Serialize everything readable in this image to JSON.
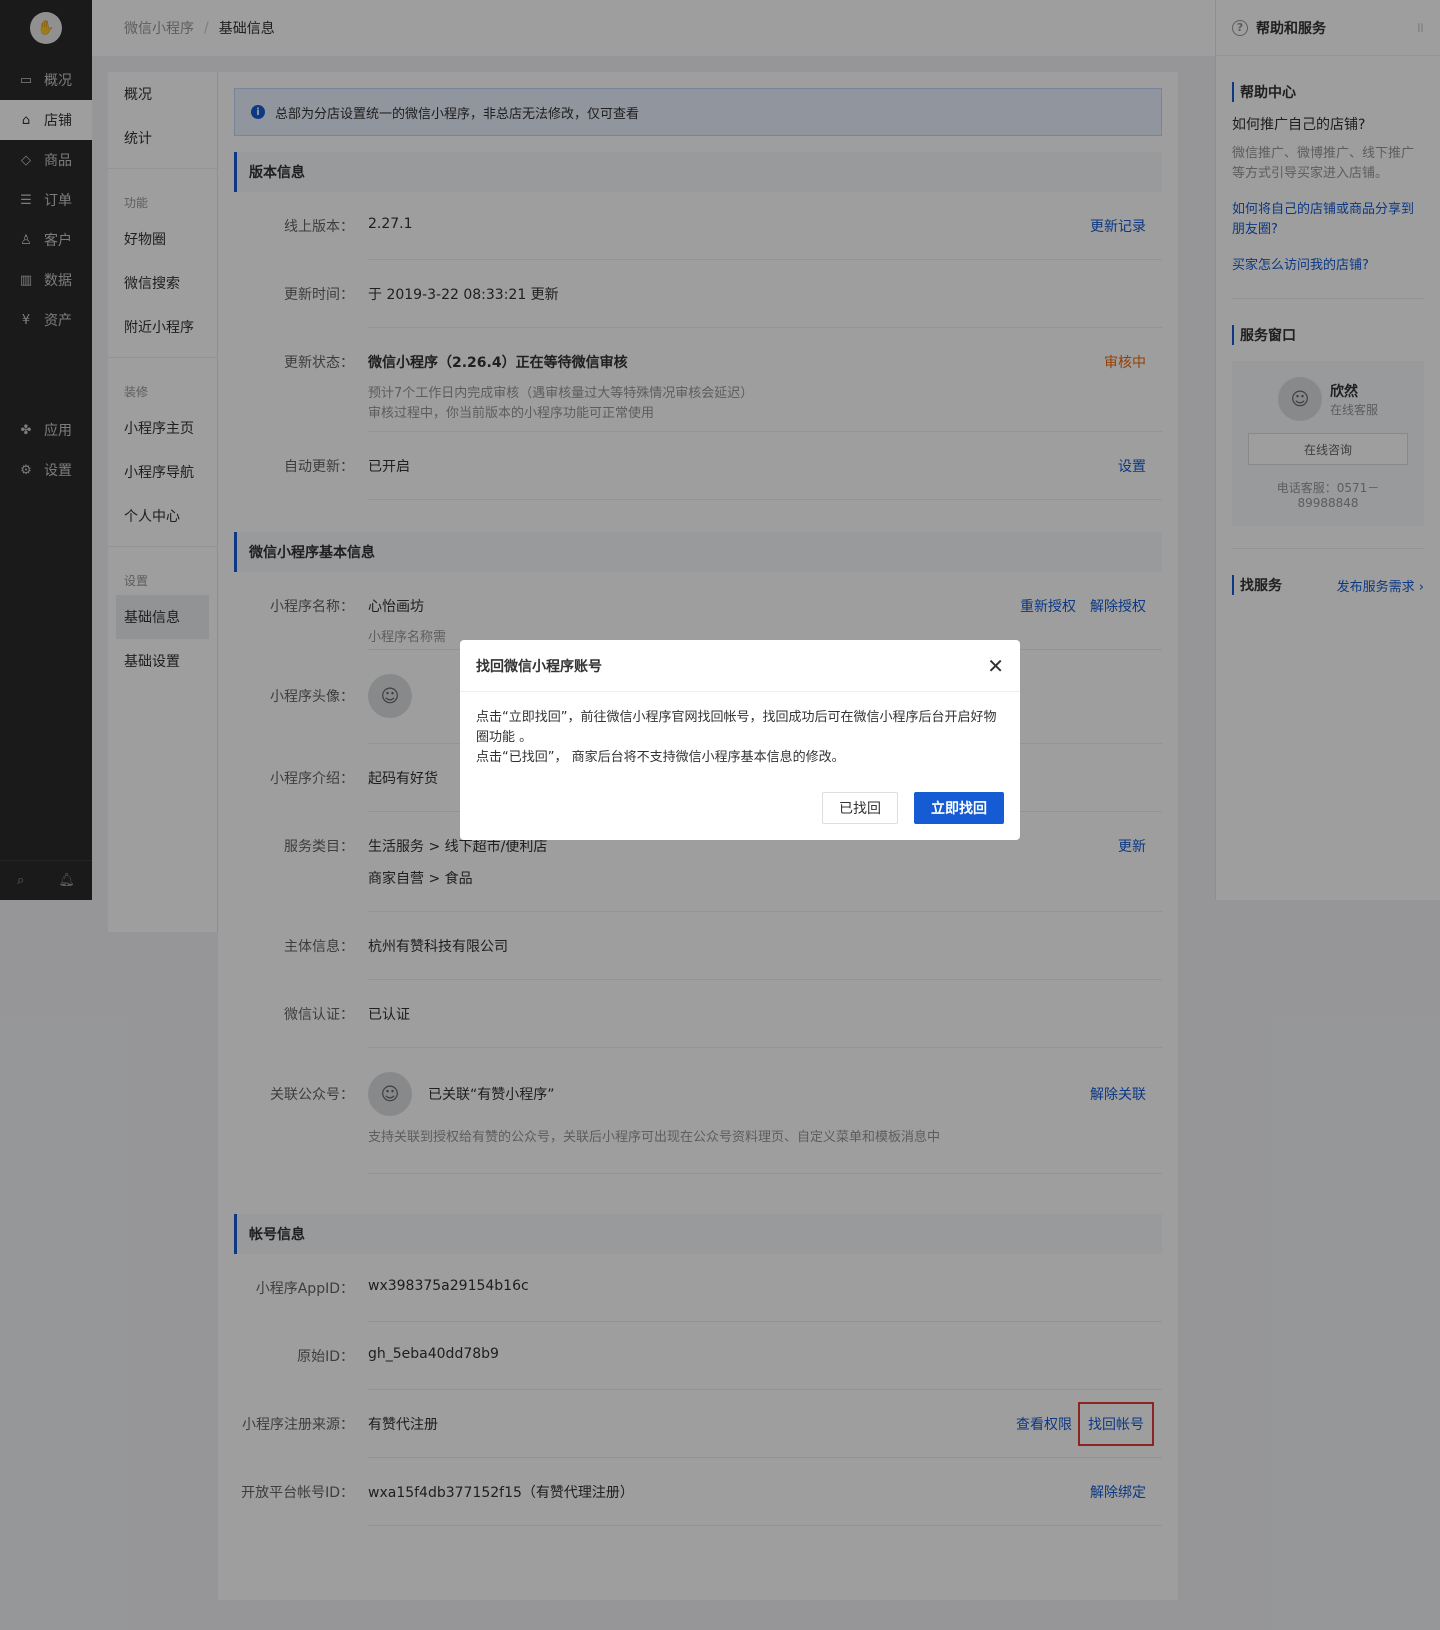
{
  "left_nav": {
    "items": [
      {
        "icon": "monitor-icon",
        "glyph": "▭",
        "label": "概况",
        "active": false
      },
      {
        "icon": "store-icon",
        "glyph": "⌂",
        "label": "店铺",
        "active": true
      },
      {
        "icon": "tag-icon",
        "glyph": "◇",
        "label": "商品",
        "active": false
      },
      {
        "icon": "order-icon",
        "glyph": "☰",
        "label": "订单",
        "active": false
      },
      {
        "icon": "customer-icon",
        "glyph": "♙",
        "label": "客户",
        "active": false
      },
      {
        "icon": "data-icon",
        "glyph": "▥",
        "label": "数据",
        "active": false
      },
      {
        "icon": "asset-icon",
        "glyph": "¥",
        "label": "资产",
        "active": false
      }
    ],
    "items2": [
      {
        "icon": "apps-icon",
        "glyph": "✤",
        "label": "应用"
      },
      {
        "icon": "settings-icon",
        "glyph": "⚙",
        "label": "设置"
      }
    ]
  },
  "breadcrumb": {
    "parent": "微信小程序",
    "sep": "/",
    "current": "基础信息"
  },
  "sub_nav": {
    "top": [
      "概况",
      "统计"
    ],
    "group1": "功能",
    "group1_items": [
      "好物圈",
      "微信搜索",
      "附近小程序"
    ],
    "group2": "装修",
    "group2_items": [
      "小程序主页",
      "小程序导航",
      "个人中心"
    ],
    "group3": "设置",
    "group3_items": [
      "基础信息",
      "基础设置"
    ]
  },
  "notice": "总部为分店设置统一的微信小程序，非总店无法修改，仅可查看",
  "version": {
    "title": "版本信息",
    "online_label": "线上版本：",
    "online_value": "2.27.1",
    "online_action": "更新记录",
    "time_label": "更新时间：",
    "time_value": "于 2019-3-22 08:33:21 更新",
    "status_label": "更新状态：",
    "status_value": "微信小程序（2.26.4）正在等待微信审核",
    "status_badge": "审核中",
    "status_sub1": "预计7个工作日内完成审核（遇审核量过大等特殊情况审核会延迟）",
    "status_sub2": "审核过程中，你当前版本的小程序功能可正常使用",
    "auto_label": "自动更新：",
    "auto_value": "已开启",
    "auto_action": "设置"
  },
  "basic": {
    "title": "微信小程序基本信息",
    "name_label": "小程序名称：",
    "name_value": "心怡画坊",
    "name_sub": "小程序名称需",
    "name_action1": "重新授权",
    "name_action2": "解除授权",
    "avatar_label": "小程序头像：",
    "intro_label": "小程序介绍：",
    "intro_value": "起码有好货",
    "category_label": "服务类目：",
    "category_value1": "生活服务 > 线下超市/便利店",
    "category_value2": "商家自营 > 食品",
    "category_action": "更新",
    "subject_label": "主体信息：",
    "subject_value": "杭州有赞科技有限公司",
    "auth_label": "微信认证：",
    "auth_value": "已认证",
    "linked_label": "关联公众号：",
    "linked_value": "已关联“有赞小程序”",
    "linked_sub": "支持关联到授权给有赞的公众号，关联后小程序可出现在公众号资料理页、自定义菜单和模板消息中",
    "linked_action": "解除关联"
  },
  "account": {
    "title": "帐号信息",
    "appid_label": "小程序AppID：",
    "appid_value": "wx398375a29154b16c",
    "origin_label": "原始ID：",
    "origin_value": "gh_5eba40dd78b9",
    "source_label": "小程序注册来源：",
    "source_value": "有赞代注册",
    "source_action1": "查看权限",
    "source_action2": "找回帐号",
    "open_label": "开放平台帐号ID：",
    "open_value": "wxa15f4db377152f15（有赞代理注册）",
    "open_action": "解除绑定"
  },
  "right_panel": {
    "header": "帮助和服务",
    "help_title": "帮助中心",
    "q1": "如何推广自己的店铺?",
    "a1": "微信推广、微博推广、线下推广等方式引导买家进入店铺。",
    "link1": "如何将自己的店铺或商品分享到朋友圈?",
    "link2": "买家怎么访问我的店铺?",
    "service_title": "服务窗口",
    "svc_name": "欣然",
    "svc_role": "在线客服",
    "svc_button": "在线咨询",
    "svc_phone": "电话客服：0571－89988848",
    "find_title": "找服务",
    "find_link": "发布服务需求 ›"
  },
  "dialog": {
    "title": "找回微信小程序账号",
    "line1": "点击“立即找回”，前往微信小程序官网找回帐号，找回成功后可在微信小程序后台开启好物圈功能 。",
    "line2": "点击“已找回”， 商家后台将不支持微信小程序基本信息的修改。",
    "btn_secondary": "已找回",
    "btn_primary": "立即找回"
  },
  "colors": {
    "primary": "#155bd4",
    "orange": "#ed6a0c",
    "highlight": "#e23b3b"
  }
}
